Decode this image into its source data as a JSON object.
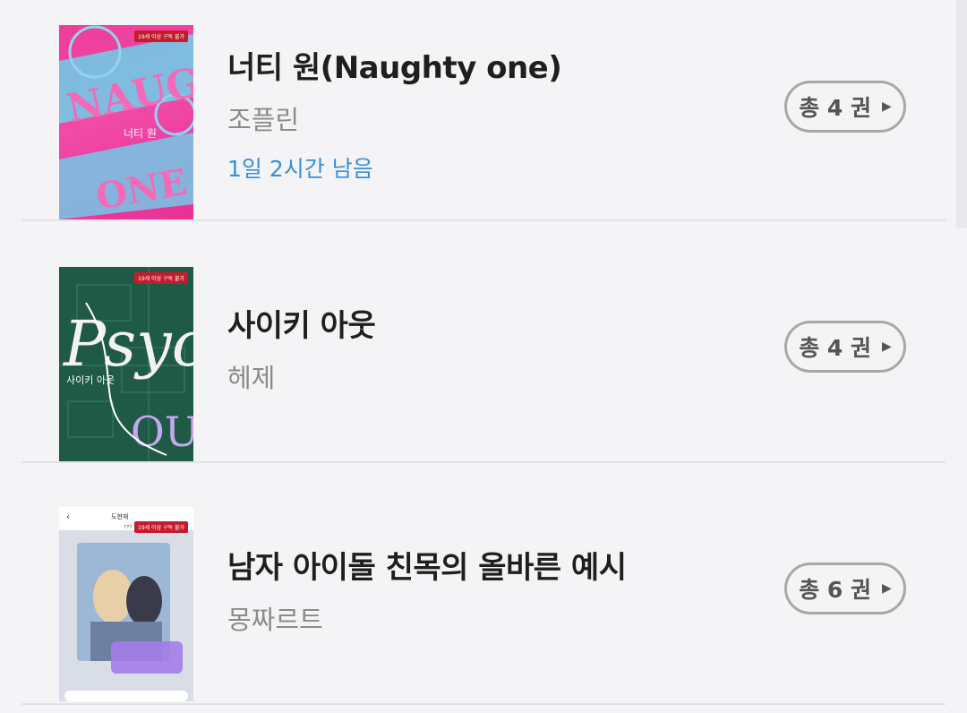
{
  "books": [
    {
      "title": "너티 원(Naughty one)",
      "author": "조플린",
      "remaining": "1일 2시간 남음",
      "volumes_label": "총 4 권",
      "badge": "19세 이상 구독 불가",
      "cover_text": [
        "NAUGHTY",
        "ONE",
        "너티 원"
      ]
    },
    {
      "title": "사이키 아웃",
      "author": "헤제",
      "remaining": "",
      "volumes_label": "총 4 권",
      "badge": "19세 이상 구독 불가",
      "cover_text": [
        "Psych",
        "OUT",
        "사이키 아웃"
      ]
    },
    {
      "title": "남자 아이돌 친목의 올바른 예시",
      "author": "몽짜르트",
      "remaining": "",
      "volumes_label": "총 6 권",
      "badge": "19세 이상 구독 불가",
      "cover_text": [
        "도현재",
        "남자 아이돌 친목의 올바른 예시",
        "777"
      ]
    }
  ],
  "icons": {
    "arrow": "triangle-right-icon"
  },
  "colors": {
    "background": "#f4f4f6",
    "remaining": "#3a8fd6",
    "button_border": "#a8a8a8"
  }
}
